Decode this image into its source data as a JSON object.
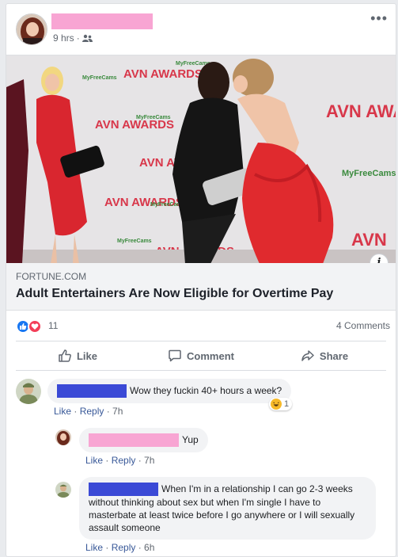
{
  "post": {
    "time": "9 hrs",
    "privacy_icon": "friends-icon",
    "more_label": "•••"
  },
  "link": {
    "domain": "FORTUNE.COM",
    "title": "Adult Entertainers Are Now Eligible for Overtime Pay",
    "info_label": "i",
    "backdrop_text": [
      "AVN AWARDS",
      "MyFreeCams"
    ]
  },
  "reactions": {
    "count": "11",
    "comments": "4 Comments",
    "colors": {
      "like": "#1877f2",
      "love": "#f33e58"
    }
  },
  "actions": {
    "like": "Like",
    "comment": "Comment",
    "share": "Share"
  },
  "comments": [
    {
      "text": "Wow they fuckin 40+ hours a week?",
      "like": "Like",
      "reply": "Reply",
      "time": "7h",
      "reaction_count": "1",
      "redact_color": "#3b4ad6"
    },
    {
      "text": "Yup",
      "like": "Like",
      "reply": "Reply",
      "time": "7h",
      "redact_color": "#f8a5d3"
    },
    {
      "text": "When I'm in a relationship I can go 2-3 weeks without thinking about sex but when I'm single I have to masterbate at least twice before I go anywhere or I will sexually assault someone",
      "like": "Like",
      "reply": "Reply",
      "time": "6h",
      "redact_color": "#3b4ad6"
    }
  ]
}
